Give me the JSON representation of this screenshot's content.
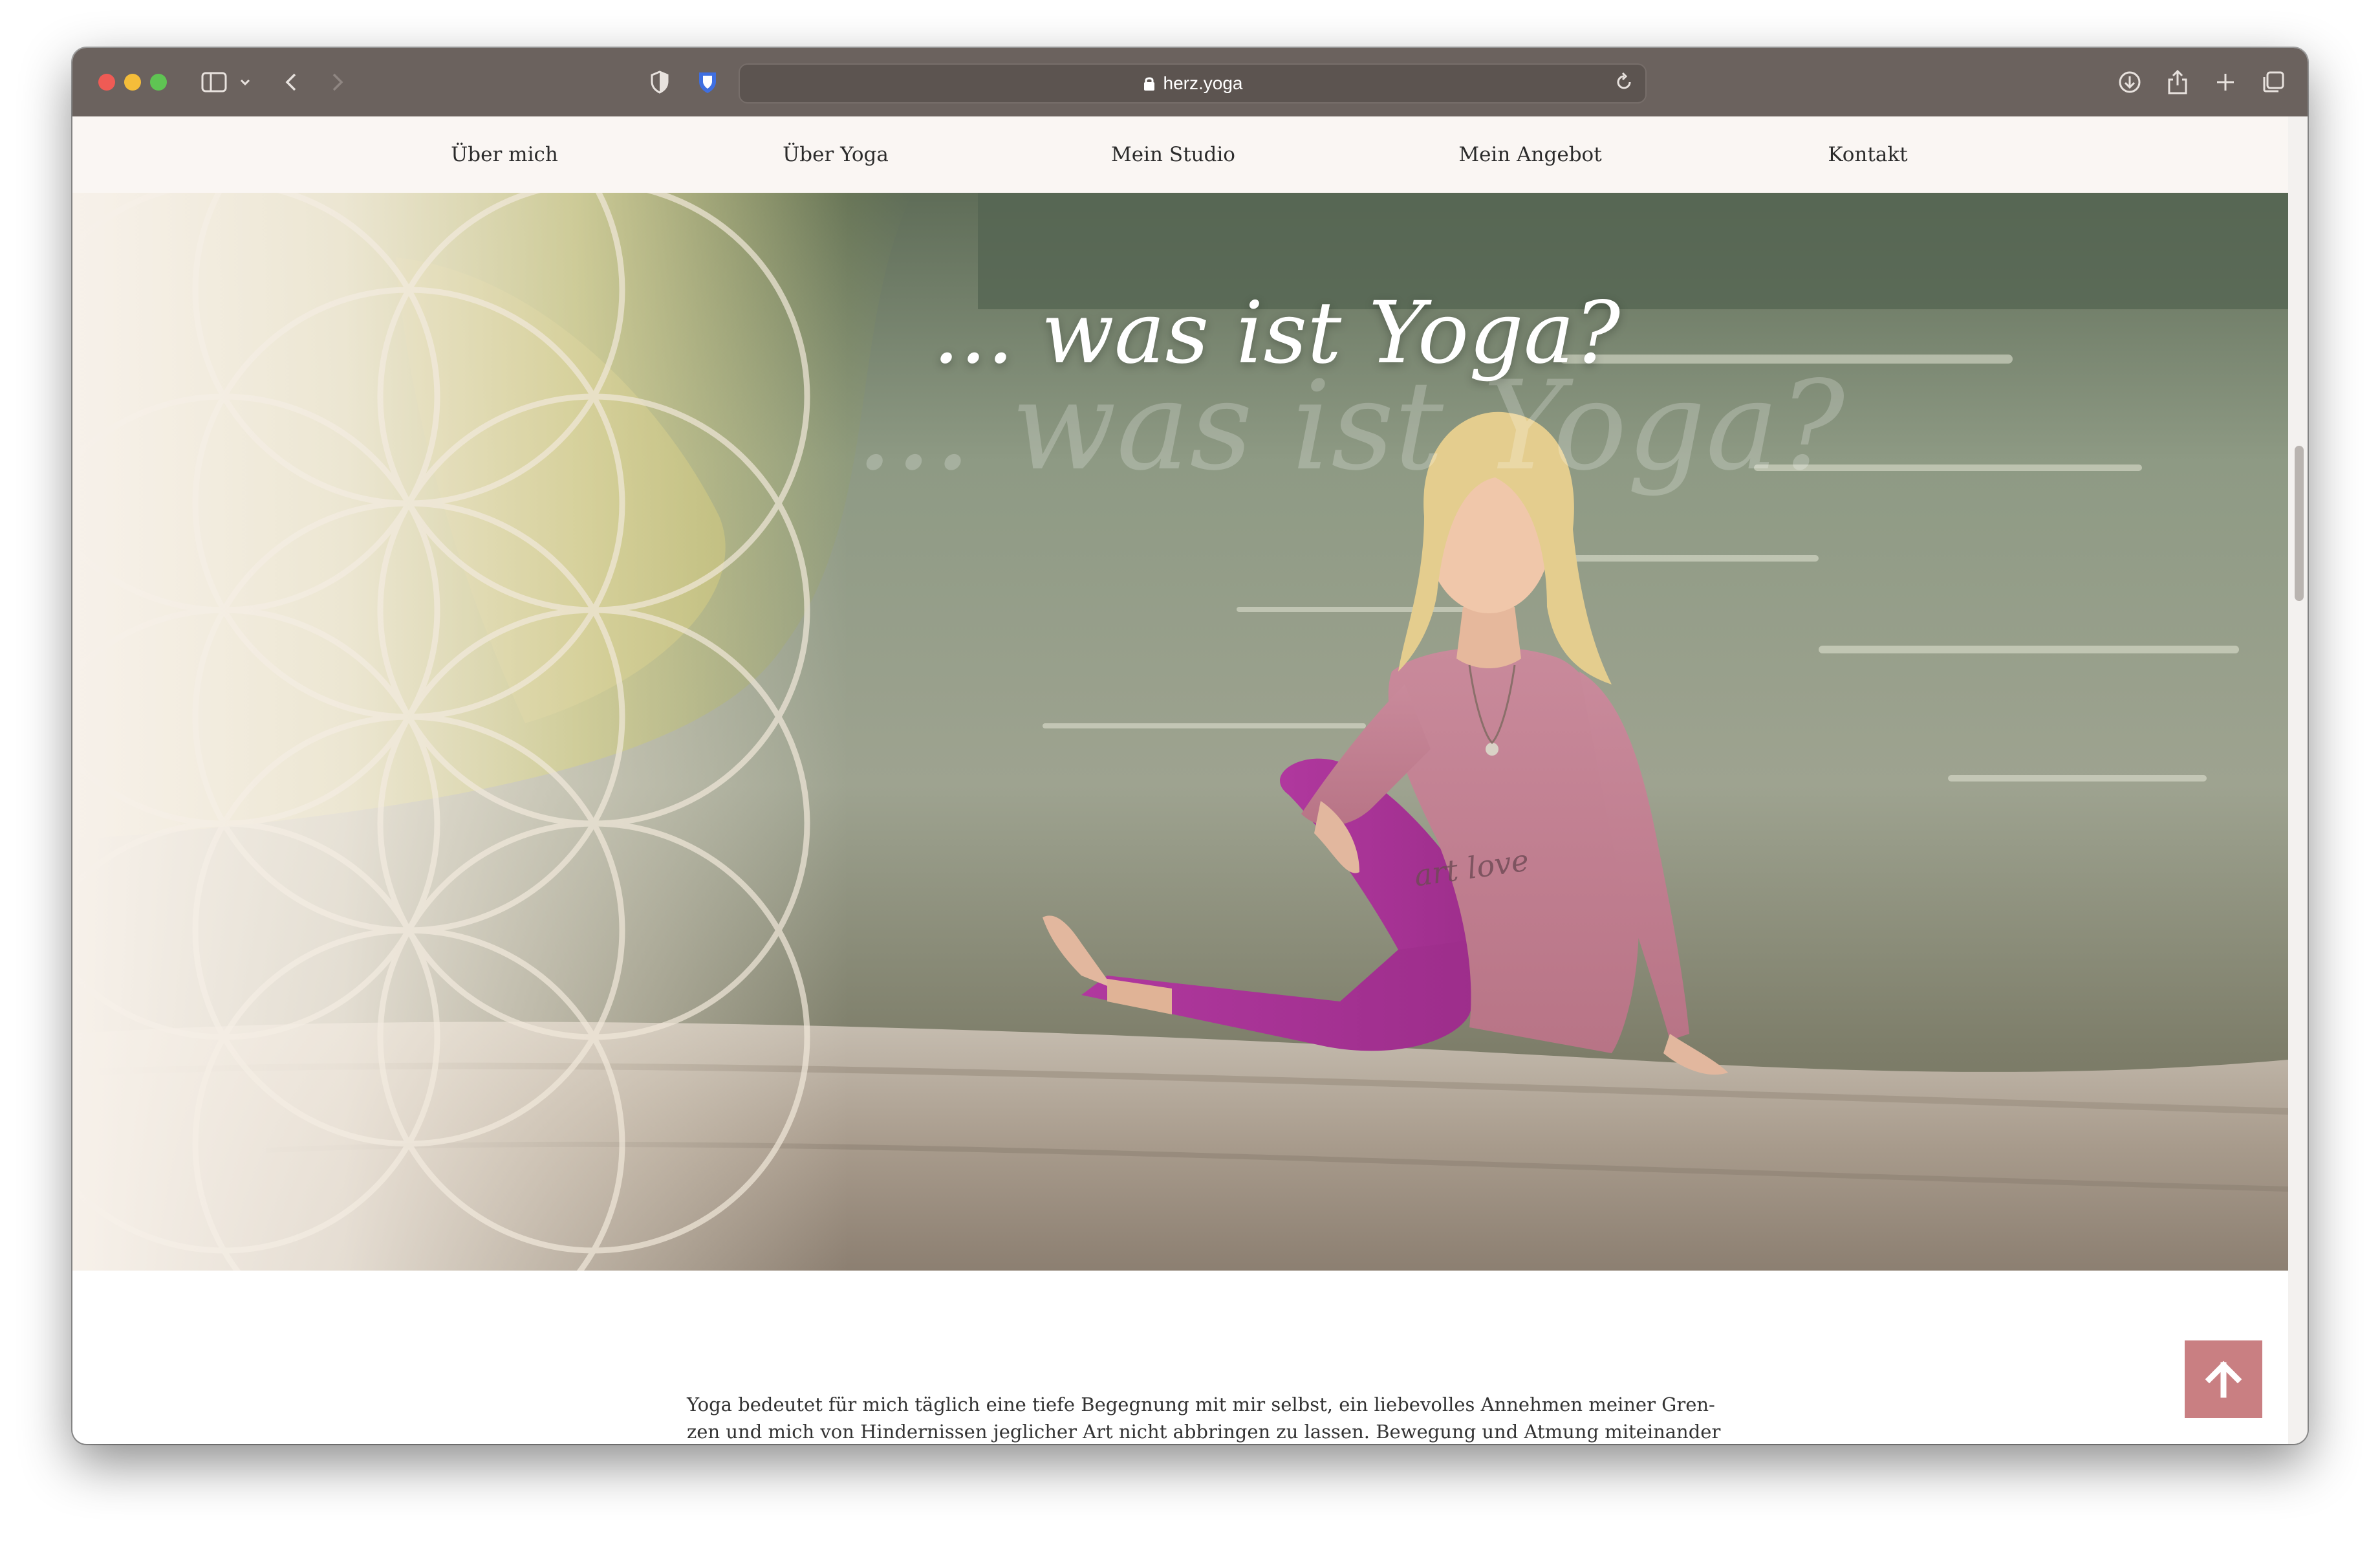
{
  "browser": {
    "url": "herz.yoga"
  },
  "nav": {
    "items": [
      {
        "label": "Über mich"
      },
      {
        "label": "Über Yoga"
      },
      {
        "label": "Mein Studio"
      },
      {
        "label": "Mein Angebot"
      },
      {
        "label": "Kontakt"
      }
    ]
  },
  "hero": {
    "title": "... was ist Yoga?",
    "shirt_text": "art love"
  },
  "content": {
    "paragraph_lines": [
      "Yoga bedeutet für mich täglich eine tiefe Begegnung mit mir selbst, ein liebevolles Annehmen meiner Gren-",
      "zen und mich von Hindernissen jeglicher Art nicht abbringen zu lassen. Bewegung und Atmung miteinander"
    ]
  },
  "icons": {
    "lock": "lock-icon",
    "back_to_top": "arrow-up-icon"
  },
  "colors": {
    "toolbar": "#6b625e",
    "nav_background": "#faf6f3",
    "accent_button": "#c97f82",
    "leggings": "#b03a9e",
    "shirt": "#c47c93"
  }
}
